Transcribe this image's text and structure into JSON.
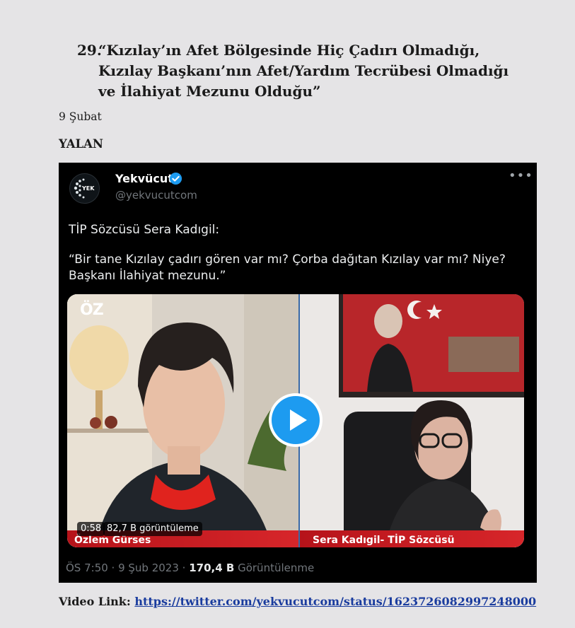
{
  "heading": {
    "number": "29.",
    "title": "“Kızılay’ın Afet Bölgesinde Hiç Çadırı Olmadığı, Kızılay Başkanı’nın Afet/Yardım Tecrübesi Olmadığı ve İlahiyat Mezunu Olduğu”"
  },
  "date": "9 Şubat",
  "verdict": "YALAN",
  "tweet": {
    "account_name": "Yekvücut",
    "handle": "@yekvucutcom",
    "more_label": "•••",
    "avatar_text": "YEK",
    "text_line1": "TİP Sözcüsü Sera Kadıgil:",
    "text_line2": "“Bir tane Kızılay çadırı gören var mı? Çorba dağıtan Kızılay var mı? Niye? Başkanı İlahiyat mezunu.”",
    "video": {
      "show_logo": "ÖZ",
      "left_caption": "Özlem Gürses",
      "right_caption": "Sera Kadıgil- TİP Sözcüsü",
      "duration": "0:58",
      "views": "82,7 B görüntüleme"
    },
    "meta": {
      "time": "ÖS 7:50 · 9 Şub 2023 · ",
      "view_count": "170,4 B",
      "view_label": "Görüntülenme"
    }
  },
  "video_link": {
    "label": "Video Link:",
    "url": "https://twitter.com/yekvucutcom/status/1623726082997248000"
  },
  "colors": {
    "page_bg": "#e5e4e6",
    "tweet_bg": "#000000",
    "verified_blue": "#1d9bf0",
    "link_blue": "#1a3c9e",
    "caption_red": "#c81d23"
  }
}
